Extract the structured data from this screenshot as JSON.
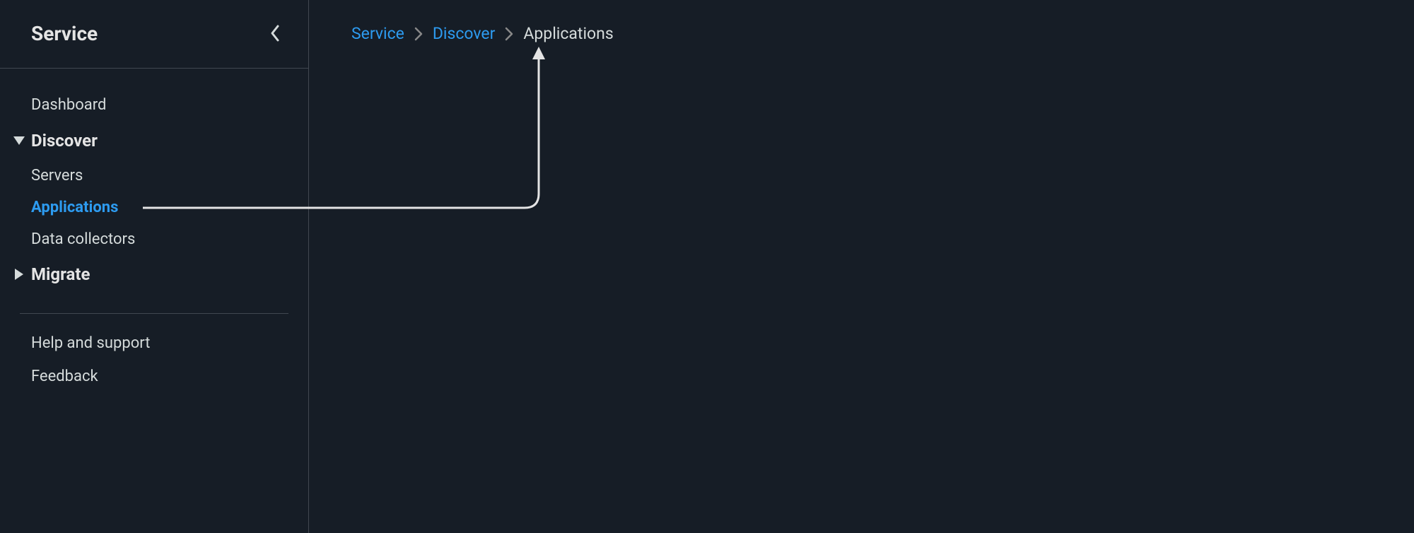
{
  "sidebar": {
    "title": "Service",
    "nav": {
      "dashboard": "Dashboard",
      "discover": {
        "label": "Discover",
        "servers": "Servers",
        "applications": "Applications",
        "dataCollectors": "Data collectors"
      },
      "migrate": {
        "label": "Migrate"
      },
      "help": "Help and support",
      "feedback": "Feedback"
    }
  },
  "breadcrumb": {
    "service": "Service",
    "discover": "Discover",
    "applications": "Applications"
  }
}
